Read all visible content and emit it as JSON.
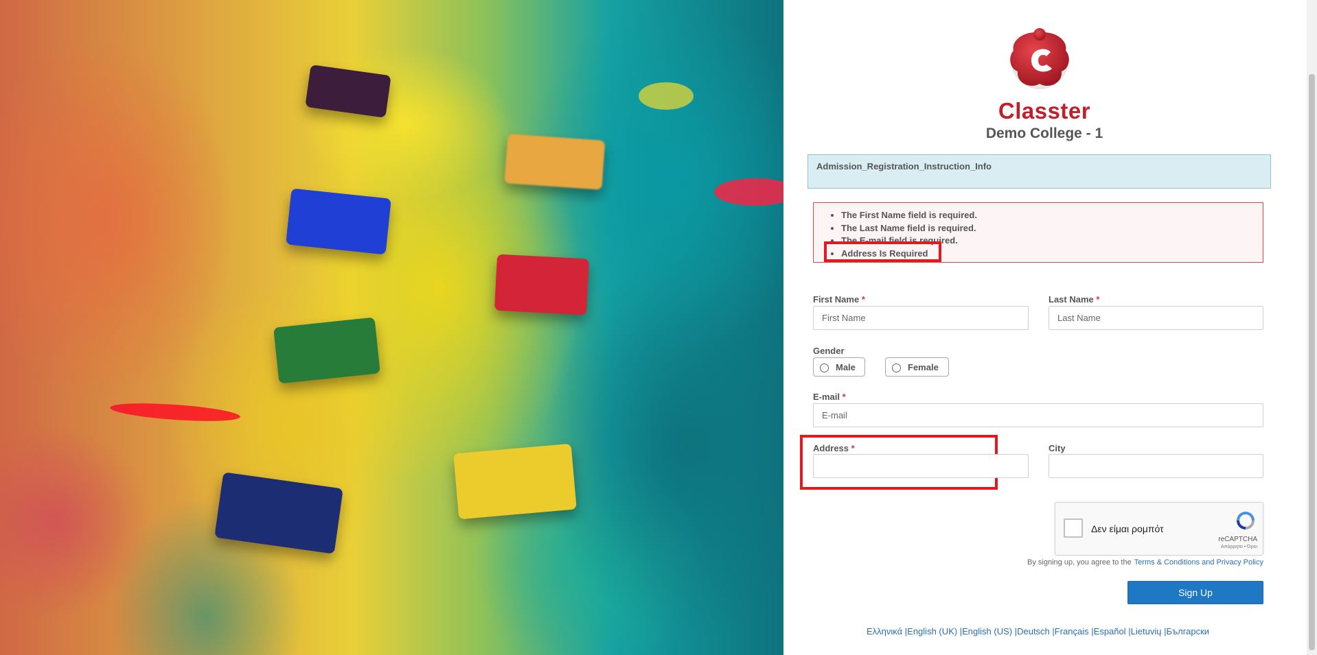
{
  "brand": {
    "name": "Classter",
    "college": "Demo College - 1"
  },
  "info": {
    "text": "Admission_Registration_Instruction_Info"
  },
  "errors": [
    "The First Name field is required.",
    "The Last Name field is required.",
    "The E-mail field is required.",
    "Address Is Required"
  ],
  "form": {
    "first_name": {
      "label": "First Name",
      "required": "*",
      "placeholder": "First Name"
    },
    "last_name": {
      "label": "Last Name",
      "required": "*",
      "placeholder": "Last Name"
    },
    "gender": {
      "label": "Gender",
      "options": [
        "Male",
        "Female"
      ]
    },
    "email": {
      "label": "E-mail",
      "required": "*",
      "placeholder": "E-mail"
    },
    "address": {
      "label": "Address",
      "required": "*",
      "placeholder": ""
    },
    "city": {
      "label": "City",
      "placeholder": ""
    }
  },
  "captcha": {
    "label": "Δεν είμαι ρομπότ",
    "brand": "reCAPTCHA",
    "sub": "Απόρρητο • Όροι"
  },
  "terms": {
    "text": "By signing up, you agree to the",
    "link": "Terms & Conditions and Privacy Policy"
  },
  "signup_label": "Sign Up",
  "languages": [
    "Ελληνικά",
    "|English (UK)",
    "|English (US)",
    "|Deutsch",
    "|Français",
    "|Español",
    "|Lietuvių",
    "|Български"
  ],
  "colors": {
    "brand_red": "#c0202a",
    "highlight_red": "#e8161e",
    "primary_blue": "#1f78c3",
    "info_bg": "#d9edf2"
  }
}
